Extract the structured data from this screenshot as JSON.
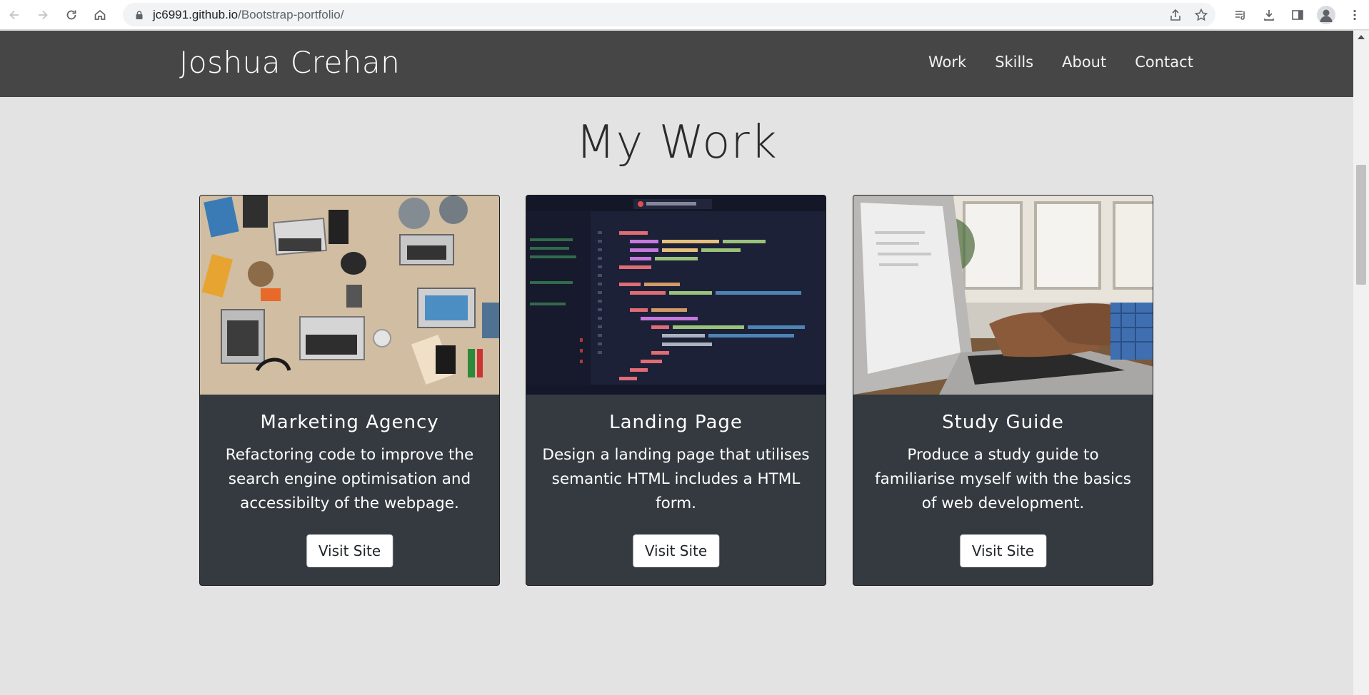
{
  "browser": {
    "url_host": "jc6991.github.io",
    "url_path": "/Bootstrap-portfolio/",
    "icons": [
      "back-icon",
      "forward-icon",
      "reload-icon",
      "home-icon",
      "lock-icon",
      "share-icon",
      "star-icon",
      "reading-list-icon",
      "download-icon",
      "side-panel-icon",
      "profile-icon",
      "menu-icon"
    ]
  },
  "navbar": {
    "brand": "Joshua Crehan",
    "links": [
      "Work",
      "Skills",
      "About",
      "Contact"
    ],
    "bg_color": "#464646"
  },
  "main": {
    "title": "My Work",
    "cards": [
      {
        "title": "Marketing Agency",
        "description": "Refactoring code to improve the search engine optimisation and accessibilty of the webpage.",
        "button": "Visit Site",
        "image": "desk-with-laptops-image"
      },
      {
        "title": "Landing Page",
        "description": "Design a landing page that utilises semantic HTML includes a HTML form.",
        "button": "Visit Site",
        "image": "code-editor-image"
      },
      {
        "title": "Study Guide",
        "description": "Produce a study guide to familiarise myself with the basics of web development.",
        "button": "Visit Site",
        "image": "typing-on-laptop-image"
      }
    ],
    "card_color": "#343a40"
  }
}
